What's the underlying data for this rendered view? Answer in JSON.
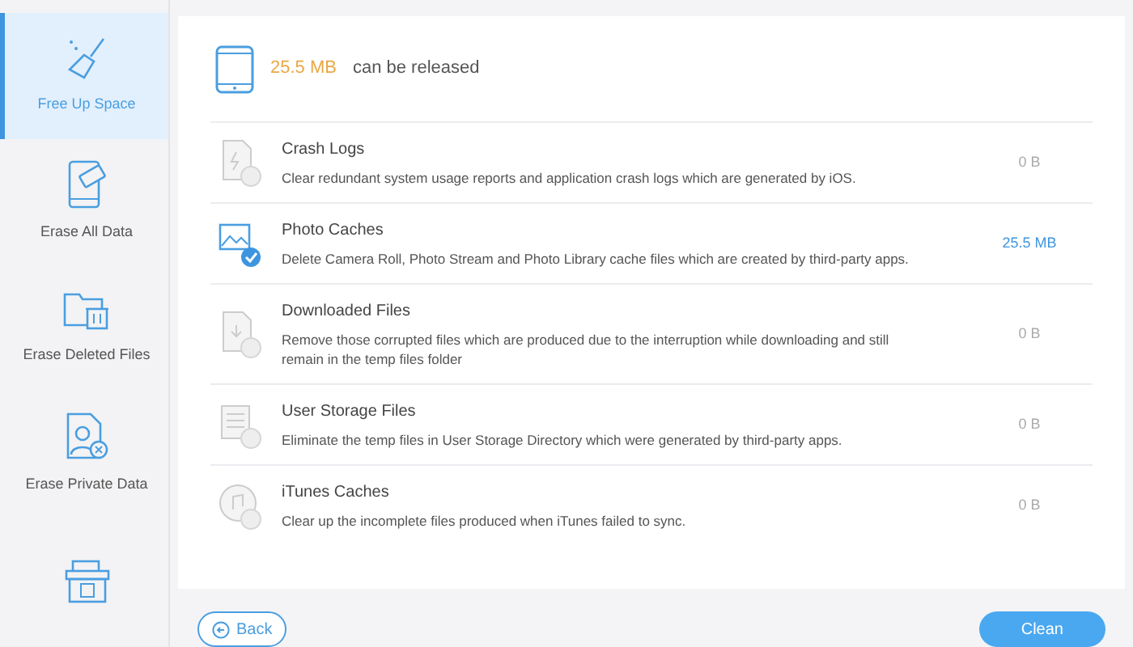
{
  "sidebar": {
    "items": [
      {
        "label": "Free Up Space",
        "selected": true,
        "kind": "broom"
      },
      {
        "label": "Erase All Data",
        "selected": false,
        "kind": "phone-eraser"
      },
      {
        "label": "Erase Deleted Files",
        "selected": false,
        "kind": "folder-trash"
      },
      {
        "label": "Erase Private Data",
        "selected": false,
        "kind": "person-file"
      },
      {
        "selected": false,
        "kind": "box"
      }
    ]
  },
  "summary": {
    "size": "25.5 MB",
    "text": "can be released"
  },
  "items": [
    {
      "title": "Crash Logs",
      "description": "Clear redundant system usage reports and application crash logs which are generated by iOS.",
      "size": "0 B",
      "checked": false,
      "kind": "crash"
    },
    {
      "title": "Photo Caches",
      "description": "Delete Camera Roll, Photo Stream and Photo Library cache files which are created by third-party apps.",
      "size": "25.5 MB",
      "checked": true,
      "kind": "photo"
    },
    {
      "title": "Downloaded Files",
      "description": "Remove those corrupted files which are produced due to the interruption while downloading and still remain in the temp files folder",
      "size": "0 B",
      "checked": false,
      "kind": "download"
    },
    {
      "title": "User Storage Files",
      "description": "Eliminate the temp files in User Storage Directory which were generated by third-party apps.",
      "size": "0 B",
      "checked": false,
      "kind": "storage"
    },
    {
      "title": "iTunes Caches",
      "description": "Clear up the incomplete files produced when iTunes failed to sync.",
      "size": "0 B",
      "checked": false,
      "kind": "music"
    }
  ],
  "buttons": {
    "back": "Back",
    "clean": "Clean"
  }
}
